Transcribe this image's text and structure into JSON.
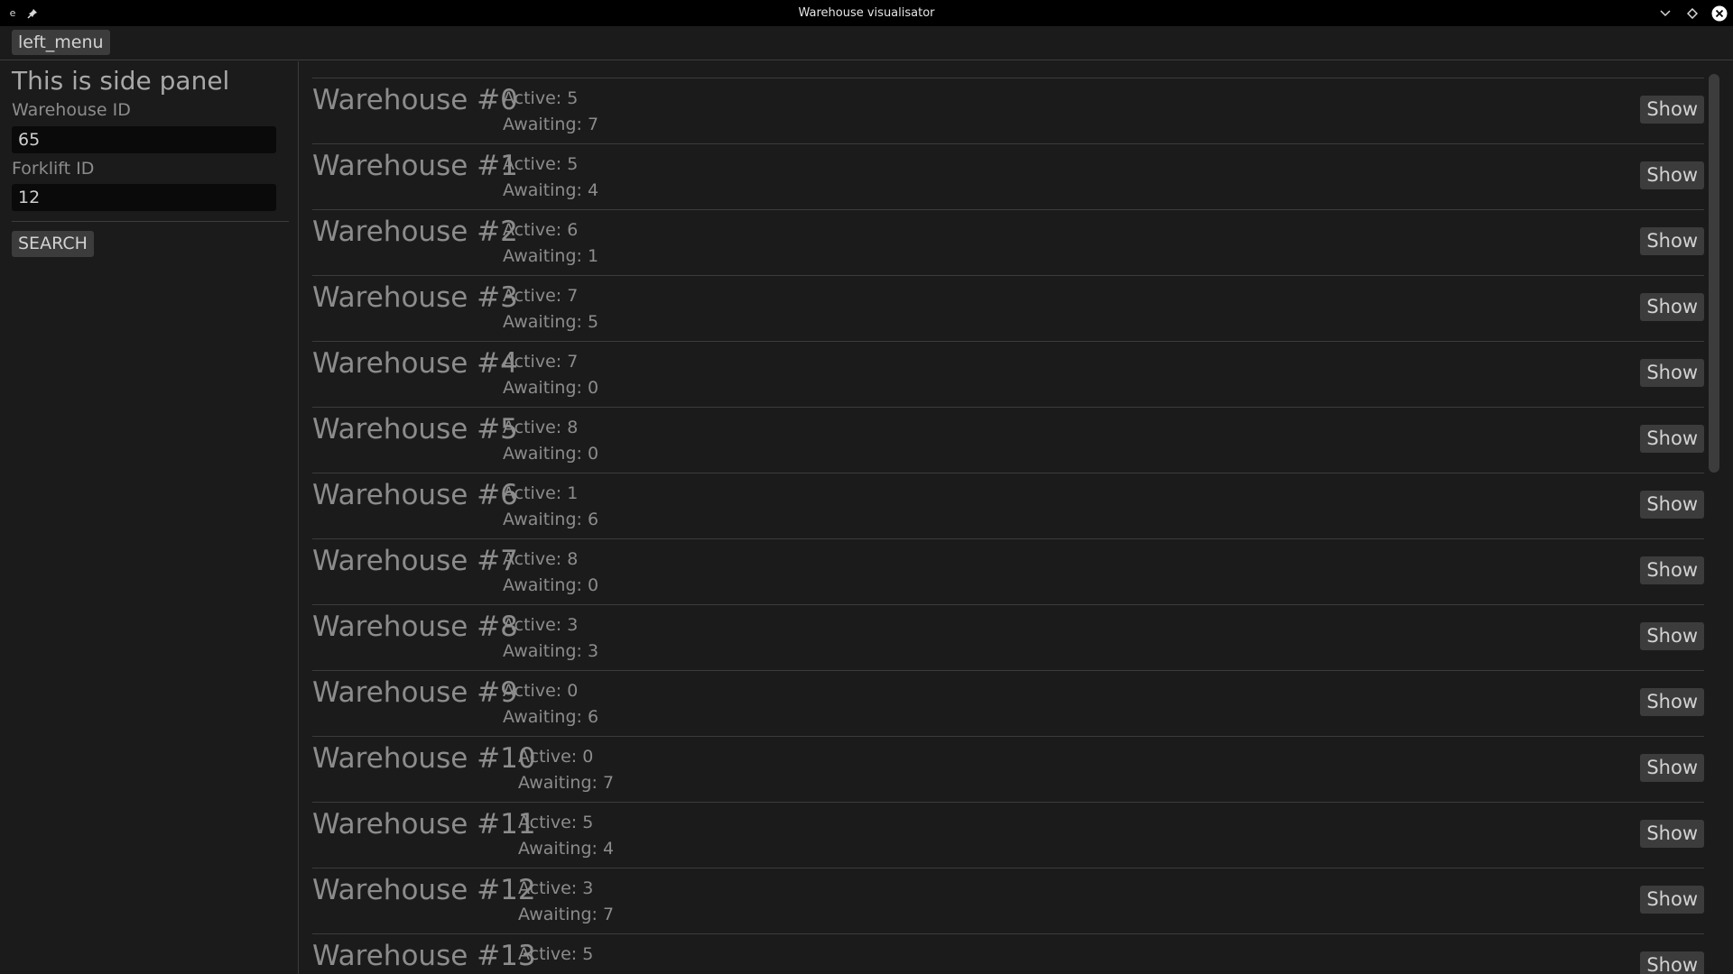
{
  "window": {
    "title": "Warehouse visualisator"
  },
  "menubar": {
    "left_menu_label": "left_menu"
  },
  "side_panel": {
    "title": "This is side panel",
    "warehouse_id_label": "Warehouse ID",
    "warehouse_id_value": "65",
    "forklift_id_label": "Forklift ID",
    "forklift_id_value": "12",
    "search_label": "SEARCH"
  },
  "warehouses": [
    {
      "name": "Warehouse #0",
      "active": "Active: 5",
      "awaiting": "Awaiting: 7",
      "button": "Show"
    },
    {
      "name": "Warehouse #1",
      "active": "Active: 5",
      "awaiting": "Awaiting: 4",
      "button": "Show"
    },
    {
      "name": "Warehouse #2",
      "active": "Active: 6",
      "awaiting": "Awaiting: 1",
      "button": "Show"
    },
    {
      "name": "Warehouse #3",
      "active": "Active: 7",
      "awaiting": "Awaiting: 5",
      "button": "Show"
    },
    {
      "name": "Warehouse #4",
      "active": "Active: 7",
      "awaiting": "Awaiting: 0",
      "button": "Show"
    },
    {
      "name": "Warehouse #5",
      "active": "Active: 8",
      "awaiting": "Awaiting: 0",
      "button": "Show"
    },
    {
      "name": "Warehouse #6",
      "active": "Active: 1",
      "awaiting": "Awaiting: 6",
      "button": "Show"
    },
    {
      "name": "Warehouse #7",
      "active": "Active: 8",
      "awaiting": "Awaiting: 0",
      "button": "Show"
    },
    {
      "name": "Warehouse #8",
      "active": "Active: 3",
      "awaiting": "Awaiting: 3",
      "button": "Show"
    },
    {
      "name": "Warehouse #9",
      "active": "Active: 0",
      "awaiting": "Awaiting: 6",
      "button": "Show"
    },
    {
      "name": "Warehouse #10",
      "active": "Active: 0",
      "awaiting": "Awaiting: 7",
      "button": "Show"
    },
    {
      "name": "Warehouse #11",
      "active": "Active: 5",
      "awaiting": "Awaiting: 4",
      "button": "Show"
    },
    {
      "name": "Warehouse #12",
      "active": "Active: 3",
      "awaiting": "Awaiting: 7",
      "button": "Show"
    },
    {
      "name": "Warehouse #13",
      "active": "Active: 5",
      "awaiting": "",
      "button": "Show"
    }
  ]
}
